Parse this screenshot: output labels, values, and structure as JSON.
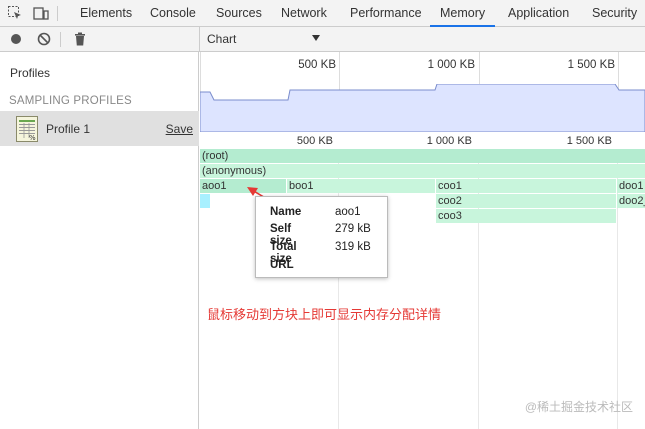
{
  "tabbar": {
    "tabs": [
      "Elements",
      "Console",
      "Sources",
      "Network",
      "Performance",
      "Memory",
      "Application",
      "Security"
    ],
    "active_tab": "Memory"
  },
  "toolbar": {
    "view_select": "Chart"
  },
  "sidebar": {
    "title": "Profiles",
    "section": "SAMPLING PROFILES",
    "profile_label": "Profile 1",
    "save_label": "Save"
  },
  "overview": {
    "ticks": [
      "500 KB",
      "1 000 KB",
      "1 500 KB"
    ]
  },
  "ruler": {
    "ticks": [
      "500 KB",
      "1 000 KB",
      "1 500 KB"
    ]
  },
  "flame": {
    "root": "(root)",
    "anonymous": "(anonymous)",
    "aoo1": "aoo1",
    "boo1": "boo1",
    "coo1": "coo1",
    "doo1": "doo1",
    "coo2": "coo2",
    "doo2": "doo2_",
    "coo3": "coo3"
  },
  "tooltip": {
    "name_key": "Name",
    "name_val": "aoo1",
    "self_key": "Self size",
    "self_val": "279 kB",
    "total_key": "Total size",
    "total_val": "319 kB",
    "url_key": "URL"
  },
  "annotation": "鼠标移动到方块上即可显示内存分配详情",
  "watermark": "@稀土掘金技术社区",
  "colors": {
    "accent": "#1a73e8",
    "flame_light": "#c8f5dc",
    "flame_mid": "#b4ecd0",
    "flame_selected": "#a8f0ff",
    "overview_fill": "#dde4ff",
    "annotation": "#e53935"
  }
}
